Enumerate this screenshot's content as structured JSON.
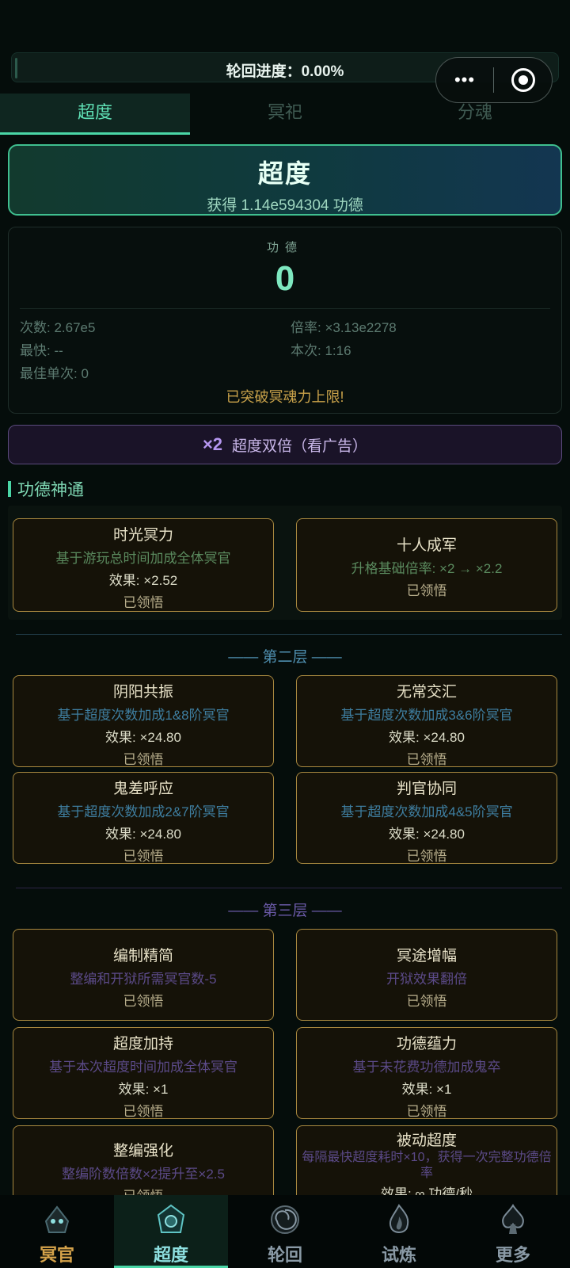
{
  "progress": {
    "label": "轮回进度：0.00%",
    "value": 0.0
  },
  "capsule": {
    "more": "•••"
  },
  "tabs": [
    {
      "label": "超度",
      "active": true
    },
    {
      "label": "冥祀",
      "active": false
    },
    {
      "label": "分魂",
      "active": false
    }
  ],
  "chaodu": {
    "title": "超度",
    "subtitle": "获得 1.14e594304 功德"
  },
  "merit": {
    "label": "功德",
    "value": "0",
    "count": "次数: 2.67e5",
    "multiplier": "倍率: ×3.13e2278",
    "fastest": "最快: --",
    "current": "本次: 1:16",
    "best_single": "最佳单次: 0",
    "note": "已突破冥魂力上限!"
  },
  "ad": {
    "badge": "×2",
    "label": "超度双倍（看广告）"
  },
  "section_title": "功德神通",
  "layer1": [
    {
      "name": "时光冥力",
      "desc": "基于游玩总时间加成全体冥官",
      "effect": "效果: ×2.52",
      "status": "已领悟"
    },
    {
      "name": "十人成军",
      "desc": "升格基础倍率: ×2 → ×2.2",
      "effect": "",
      "status": "已领悟"
    }
  ],
  "layer2_title": "第二层",
  "layer2": [
    {
      "name": "阴阳共振",
      "desc": "基于超度次数加成1&8阶冥官",
      "effect": "效果: ×24.80",
      "status": "已领悟"
    },
    {
      "name": "无常交汇",
      "desc": "基于超度次数加成3&6阶冥官",
      "effect": "效果: ×24.80",
      "status": "已领悟"
    },
    {
      "name": "鬼差呼应",
      "desc": "基于超度次数加成2&7阶冥官",
      "effect": "效果: ×24.80",
      "status": "已领悟"
    },
    {
      "name": "判官协同",
      "desc": "基于超度次数加成4&5阶冥官",
      "effect": "效果: ×24.80",
      "status": "已领悟"
    }
  ],
  "layer3_title": "第三层",
  "layer3": [
    {
      "name": "编制精简",
      "desc": "整编和开狱所需冥官数-5",
      "effect": "",
      "status": "已领悟"
    },
    {
      "name": "冥途增幅",
      "desc": "开狱效果翻倍",
      "effect": "",
      "status": "已领悟"
    },
    {
      "name": "超度加持",
      "desc": "基于本次超度时间加成全体冥官",
      "effect": "效果: ×1",
      "status": "已领悟"
    },
    {
      "name": "功德蕴力",
      "desc": "基于未花费功德加成鬼卒",
      "effect": "效果: ×1",
      "status": "已领悟"
    },
    {
      "name": "整编强化",
      "desc": "整编阶数倍数×2提升至×2.5",
      "effect": "",
      "status": "已领悟"
    },
    {
      "name": "被动超度",
      "desc": "每隔最快超度耗时×10，获得一次完整功德倍率",
      "effect": "效果: ∞ 功德/秒",
      "status": ""
    }
  ],
  "bottom_nav": [
    {
      "label": "冥官",
      "icon": "ghost-officer-icon",
      "color": "#d4a24a",
      "active": false
    },
    {
      "label": "超度",
      "icon": "lotus-crest-icon",
      "color": "#8ee0e0",
      "active": true
    },
    {
      "label": "轮回",
      "icon": "spiral-icon",
      "color": "#8a9aa6",
      "active": false
    },
    {
      "label": "试炼",
      "icon": "flame-icon",
      "color": "#8a9aa6",
      "active": false
    },
    {
      "label": "更多",
      "icon": "spade-icon",
      "color": "#8a9aa6",
      "active": false
    }
  ],
  "colors": {
    "accent": "#4ad6a6",
    "gold": "#a8883f",
    "purple": "#5a4a7c"
  }
}
